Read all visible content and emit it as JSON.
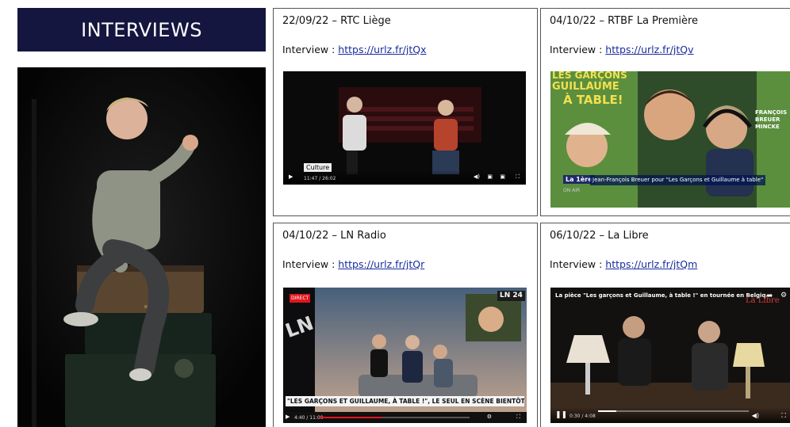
{
  "banner": {
    "title": "INTERVIEWS"
  },
  "interviews": [
    {
      "date_source": "22/09/22 – RTC Liège",
      "label": "Interview : ",
      "link": "https://urlz.fr/jtQx",
      "video": {
        "overlay": "Culture",
        "time": "11:47 / 26:02"
      }
    },
    {
      "date_source": "04/10/22 – RTBF La Première",
      "label": "Interview : ",
      "link": "https://urlz.fr/jtQv",
      "video": {
        "poster_top": "LES GARÇONS",
        "poster_mid": "GUILLAUME",
        "poster_bottom": "À TABLE!",
        "side_text": "FRANÇOIS BREUER MINCKE",
        "logo": "La 1ère",
        "caption": "Jean-François Breuer pour \"Les Garçons et Guillaume à table\"",
        "sub": "ON AIR"
      }
    },
    {
      "date_source": "04/10/22 – LN Radio",
      "label": "Interview : ",
      "link": "https://urlz.fr/jtQr",
      "video": {
        "badge": "DIRECT",
        "logo": "LN 24",
        "headline": "\"LES GARÇONS ET GUILLAUME, À TABLE !\", LE SEUL EN SCÈNE BIENTÔT EN TOURNÉE",
        "time": "4:40 / 11:00"
      }
    },
    {
      "date_source": "06/10/22 – La Libre",
      "label": "Interview : ",
      "link": "https://urlz.fr/jtQm",
      "video": {
        "title": "La pièce \"Les garçons et Guillaume, à table !\" en tournée en Belgiq...",
        "logo": "La Libre",
        "time": "0:30 / 4:08"
      }
    }
  ],
  "colors": {
    "banner": "#14163f",
    "link": "#1a2c9e",
    "ln_red": "#e0161e"
  }
}
